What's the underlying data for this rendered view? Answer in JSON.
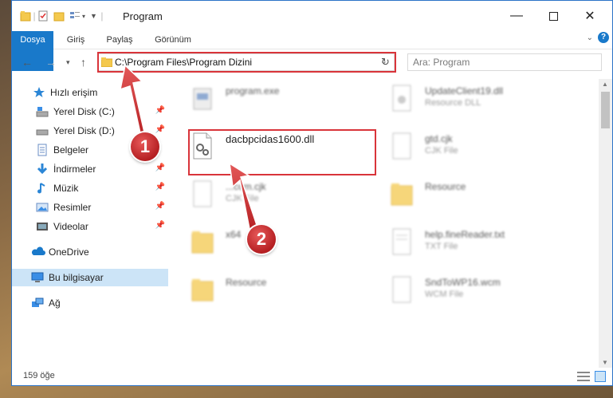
{
  "window": {
    "title": "Program"
  },
  "ribbon": {
    "tabs": [
      "Dosya",
      "Giriş",
      "Paylaş",
      "Görünüm"
    ]
  },
  "address": {
    "path": "C:\\Program Files\\Program Dizini"
  },
  "search": {
    "placeholder": "Ara: Program"
  },
  "sidebar": {
    "items": [
      {
        "label": "Hızlı erişim",
        "icon": "star-icon"
      },
      {
        "label": "Yerel Disk (C:)",
        "icon": "drive-icon"
      },
      {
        "label": "Yerel Disk (D:)",
        "icon": "drive-icon"
      },
      {
        "label": "Belgeler",
        "icon": "documents-icon"
      },
      {
        "label": "İndirmeler",
        "icon": "download-icon"
      },
      {
        "label": "Müzik",
        "icon": "music-icon"
      },
      {
        "label": "Resimler",
        "icon": "pictures-icon"
      },
      {
        "label": "Videolar",
        "icon": "videos-icon"
      },
      {
        "label": "OneDrive",
        "icon": "cloud-icon"
      },
      {
        "label": "Bu bilgisayar",
        "icon": "computer-icon"
      },
      {
        "label": "Ağ",
        "icon": "network-icon"
      }
    ]
  },
  "files": [
    {
      "name": "program.exe",
      "type": ""
    },
    {
      "name": "UpdateClient19.dll",
      "type": "Resource DLL"
    },
    {
      "name": "dacbpcidas1600.dll",
      "type": ""
    },
    {
      "name": "gtd.cjk",
      "type": "CJK File"
    },
    {
      "name": "...com.cjk",
      "type": "CJK File"
    },
    {
      "name": "Resource",
      "type": ""
    },
    {
      "name": "x64",
      "type": ""
    },
    {
      "name": "help.fineReader.txt",
      "type": "TXT File"
    },
    {
      "name": "Resource",
      "type": ""
    },
    {
      "name": "SndToWP16.wcm",
      "type": "WCM File"
    }
  ],
  "status": {
    "count": "159 öğe"
  },
  "callouts": [
    "1",
    "2"
  ],
  "colors": {
    "accent": "#1979ca",
    "highlight": "#d9343a",
    "selected": "#cce4f7"
  }
}
